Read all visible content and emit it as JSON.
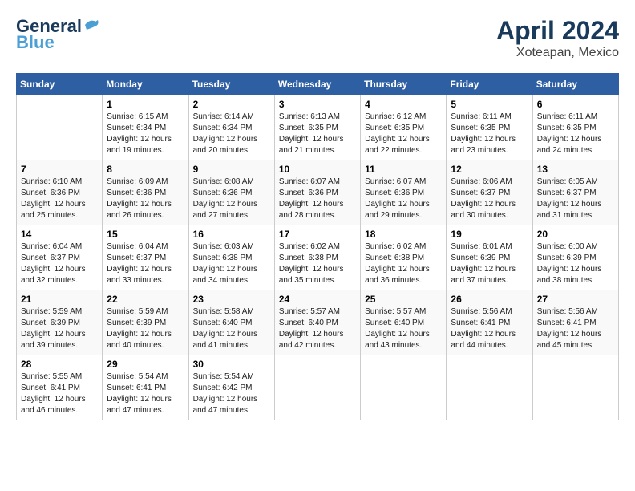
{
  "logo": {
    "line1": "General",
    "line2": "Blue"
  },
  "title": "April 2024",
  "subtitle": "Xoteapan, Mexico",
  "days_of_week": [
    "Sunday",
    "Monday",
    "Tuesday",
    "Wednesday",
    "Thursday",
    "Friday",
    "Saturday"
  ],
  "weeks": [
    [
      {
        "day": "",
        "info": ""
      },
      {
        "day": "1",
        "info": "Sunrise: 6:15 AM\nSunset: 6:34 PM\nDaylight: 12 hours\nand 19 minutes."
      },
      {
        "day": "2",
        "info": "Sunrise: 6:14 AM\nSunset: 6:34 PM\nDaylight: 12 hours\nand 20 minutes."
      },
      {
        "day": "3",
        "info": "Sunrise: 6:13 AM\nSunset: 6:35 PM\nDaylight: 12 hours\nand 21 minutes."
      },
      {
        "day": "4",
        "info": "Sunrise: 6:12 AM\nSunset: 6:35 PM\nDaylight: 12 hours\nand 22 minutes."
      },
      {
        "day": "5",
        "info": "Sunrise: 6:11 AM\nSunset: 6:35 PM\nDaylight: 12 hours\nand 23 minutes."
      },
      {
        "day": "6",
        "info": "Sunrise: 6:11 AM\nSunset: 6:35 PM\nDaylight: 12 hours\nand 24 minutes."
      }
    ],
    [
      {
        "day": "7",
        "info": "Sunrise: 6:10 AM\nSunset: 6:36 PM\nDaylight: 12 hours\nand 25 minutes."
      },
      {
        "day": "8",
        "info": "Sunrise: 6:09 AM\nSunset: 6:36 PM\nDaylight: 12 hours\nand 26 minutes."
      },
      {
        "day": "9",
        "info": "Sunrise: 6:08 AM\nSunset: 6:36 PM\nDaylight: 12 hours\nand 27 minutes."
      },
      {
        "day": "10",
        "info": "Sunrise: 6:07 AM\nSunset: 6:36 PM\nDaylight: 12 hours\nand 28 minutes."
      },
      {
        "day": "11",
        "info": "Sunrise: 6:07 AM\nSunset: 6:36 PM\nDaylight: 12 hours\nand 29 minutes."
      },
      {
        "day": "12",
        "info": "Sunrise: 6:06 AM\nSunset: 6:37 PM\nDaylight: 12 hours\nand 30 minutes."
      },
      {
        "day": "13",
        "info": "Sunrise: 6:05 AM\nSunset: 6:37 PM\nDaylight: 12 hours\nand 31 minutes."
      }
    ],
    [
      {
        "day": "14",
        "info": "Sunrise: 6:04 AM\nSunset: 6:37 PM\nDaylight: 12 hours\nand 32 minutes."
      },
      {
        "day": "15",
        "info": "Sunrise: 6:04 AM\nSunset: 6:37 PM\nDaylight: 12 hours\nand 33 minutes."
      },
      {
        "day": "16",
        "info": "Sunrise: 6:03 AM\nSunset: 6:38 PM\nDaylight: 12 hours\nand 34 minutes."
      },
      {
        "day": "17",
        "info": "Sunrise: 6:02 AM\nSunset: 6:38 PM\nDaylight: 12 hours\nand 35 minutes."
      },
      {
        "day": "18",
        "info": "Sunrise: 6:02 AM\nSunset: 6:38 PM\nDaylight: 12 hours\nand 36 minutes."
      },
      {
        "day": "19",
        "info": "Sunrise: 6:01 AM\nSunset: 6:39 PM\nDaylight: 12 hours\nand 37 minutes."
      },
      {
        "day": "20",
        "info": "Sunrise: 6:00 AM\nSunset: 6:39 PM\nDaylight: 12 hours\nand 38 minutes."
      }
    ],
    [
      {
        "day": "21",
        "info": "Sunrise: 5:59 AM\nSunset: 6:39 PM\nDaylight: 12 hours\nand 39 minutes."
      },
      {
        "day": "22",
        "info": "Sunrise: 5:59 AM\nSunset: 6:39 PM\nDaylight: 12 hours\nand 40 minutes."
      },
      {
        "day": "23",
        "info": "Sunrise: 5:58 AM\nSunset: 6:40 PM\nDaylight: 12 hours\nand 41 minutes."
      },
      {
        "day": "24",
        "info": "Sunrise: 5:57 AM\nSunset: 6:40 PM\nDaylight: 12 hours\nand 42 minutes."
      },
      {
        "day": "25",
        "info": "Sunrise: 5:57 AM\nSunset: 6:40 PM\nDaylight: 12 hours\nand 43 minutes."
      },
      {
        "day": "26",
        "info": "Sunrise: 5:56 AM\nSunset: 6:41 PM\nDaylight: 12 hours\nand 44 minutes."
      },
      {
        "day": "27",
        "info": "Sunrise: 5:56 AM\nSunset: 6:41 PM\nDaylight: 12 hours\nand 45 minutes."
      }
    ],
    [
      {
        "day": "28",
        "info": "Sunrise: 5:55 AM\nSunset: 6:41 PM\nDaylight: 12 hours\nand 46 minutes."
      },
      {
        "day": "29",
        "info": "Sunrise: 5:54 AM\nSunset: 6:41 PM\nDaylight: 12 hours\nand 47 minutes."
      },
      {
        "day": "30",
        "info": "Sunrise: 5:54 AM\nSunset: 6:42 PM\nDaylight: 12 hours\nand 47 minutes."
      },
      {
        "day": "",
        "info": ""
      },
      {
        "day": "",
        "info": ""
      },
      {
        "day": "",
        "info": ""
      },
      {
        "day": "",
        "info": ""
      }
    ]
  ]
}
